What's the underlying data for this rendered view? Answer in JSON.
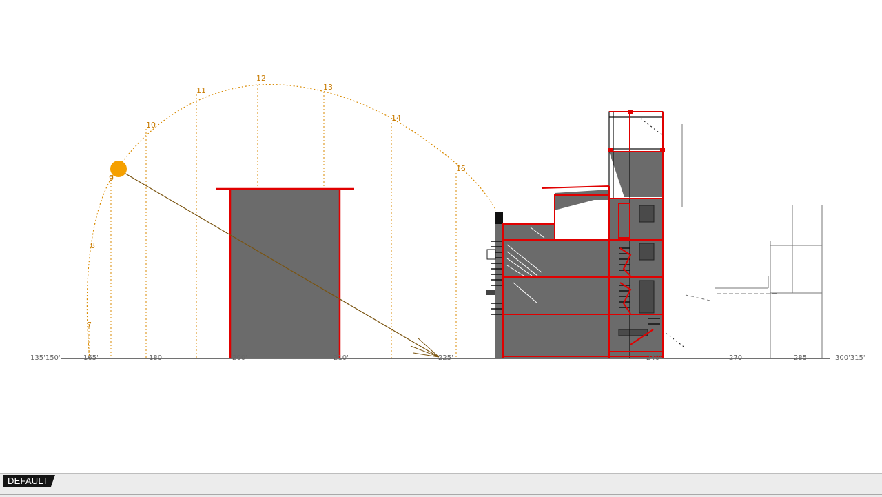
{
  "sun_path": {
    "hours": [
      "7",
      "8",
      "9",
      "10",
      "11",
      "12",
      "13",
      "14",
      "15"
    ],
    "colors": {
      "sun": "#f5a000",
      "path": "#d98a00",
      "ray": "#7a5410"
    }
  },
  "azimuth_scale": {
    "labels": [
      "135'150'",
      "165'",
      "180'",
      "200'",
      "210'",
      "225'",
      "240'",
      "270'",
      "285'",
      "300'315'"
    ]
  },
  "building": {
    "outline_color": "#e00000",
    "fill_color": "#6b6b6b"
  },
  "statusbar": {
    "layer_label": "DEFAULT"
  }
}
